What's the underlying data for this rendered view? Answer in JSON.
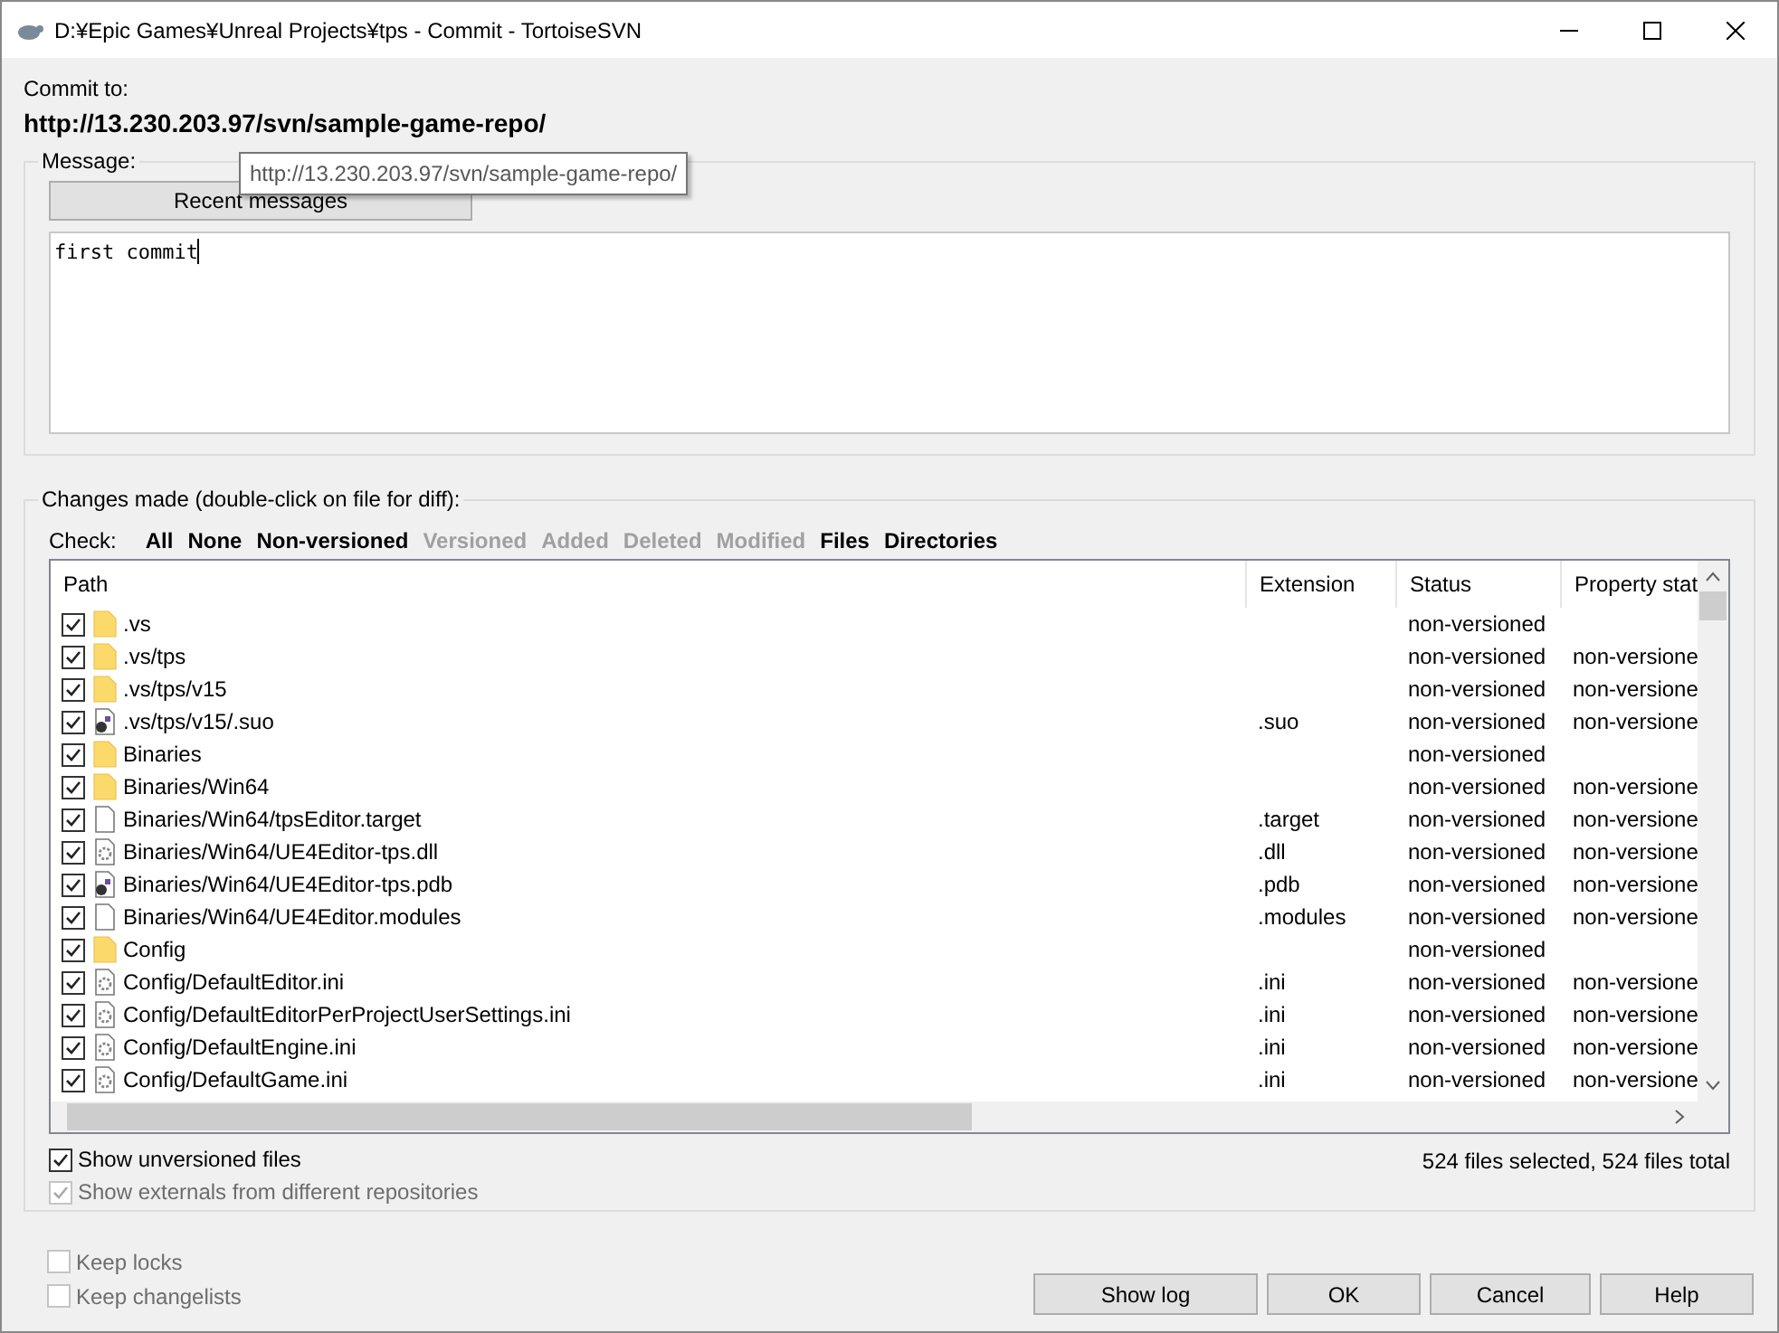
{
  "window": {
    "title": "D:¥Epic Games¥Unreal Projects¥tps - Commit - TortoiseSVN"
  },
  "commit_to": {
    "label": "Commit to:",
    "url": "http://13.230.203.97/svn/sample-game-repo/"
  },
  "tooltip": "http://13.230.203.97/svn/sample-game-repo/",
  "message": {
    "label": "Message:",
    "recent_button": "Recent messages",
    "value": "first commit "
  },
  "changes": {
    "label": "Changes made (double-click on file for diff):",
    "check_label": "Check:",
    "filters": [
      {
        "label": "All",
        "disabled": false
      },
      {
        "label": "None",
        "disabled": false
      },
      {
        "label": "Non-versioned",
        "disabled": false
      },
      {
        "label": "Versioned",
        "disabled": true
      },
      {
        "label": "Added",
        "disabled": true
      },
      {
        "label": "Deleted",
        "disabled": true
      },
      {
        "label": "Modified",
        "disabled": true
      },
      {
        "label": "Files",
        "disabled": false
      },
      {
        "label": "Directories",
        "disabled": false
      }
    ],
    "columns": [
      "Path",
      "Extension",
      "Status",
      "Property stat"
    ],
    "rows": [
      {
        "checked": true,
        "kind": "folder",
        "path": ".vs",
        "extension": "",
        "status": "non-versioned",
        "property_status": ""
      },
      {
        "checked": true,
        "kind": "folder",
        "path": ".vs/tps",
        "extension": "",
        "status": "non-versioned",
        "property_status": "non-versione"
      },
      {
        "checked": true,
        "kind": "folder",
        "path": ".vs/tps/v15",
        "extension": "",
        "status": "non-versioned",
        "property_status": "non-versione"
      },
      {
        "checked": true,
        "kind": "binary",
        "path": ".vs/tps/v15/.suo",
        "extension": ".suo",
        "status": "non-versioned",
        "property_status": "non-versione"
      },
      {
        "checked": true,
        "kind": "folder",
        "path": "Binaries",
        "extension": "",
        "status": "non-versioned",
        "property_status": ""
      },
      {
        "checked": true,
        "kind": "folder",
        "path": "Binaries/Win64",
        "extension": "",
        "status": "non-versioned",
        "property_status": "non-versione"
      },
      {
        "checked": true,
        "kind": "file",
        "path": "Binaries/Win64/tpsEditor.target",
        "extension": ".target",
        "status": "non-versioned",
        "property_status": "non-versione"
      },
      {
        "checked": true,
        "kind": "settings",
        "path": "Binaries/Win64/UE4Editor-tps.dll",
        "extension": ".dll",
        "status": "non-versioned",
        "property_status": "non-versione"
      },
      {
        "checked": true,
        "kind": "binary",
        "path": "Binaries/Win64/UE4Editor-tps.pdb",
        "extension": ".pdb",
        "status": "non-versioned",
        "property_status": "non-versione"
      },
      {
        "checked": true,
        "kind": "file",
        "path": "Binaries/Win64/UE4Editor.modules",
        "extension": ".modules",
        "status": "non-versioned",
        "property_status": "non-versione"
      },
      {
        "checked": true,
        "kind": "folder",
        "path": "Config",
        "extension": "",
        "status": "non-versioned",
        "property_status": ""
      },
      {
        "checked": true,
        "kind": "settings",
        "path": "Config/DefaultEditor.ini",
        "extension": ".ini",
        "status": "non-versioned",
        "property_status": "non-versione"
      },
      {
        "checked": true,
        "kind": "settings",
        "path": "Config/DefaultEditorPerProjectUserSettings.ini",
        "extension": ".ini",
        "status": "non-versioned",
        "property_status": "non-versione"
      },
      {
        "checked": true,
        "kind": "settings",
        "path": "Config/DefaultEngine.ini",
        "extension": ".ini",
        "status": "non-versioned",
        "property_status": "non-versione"
      },
      {
        "checked": true,
        "kind": "settings",
        "path": "Config/DefaultGame.ini",
        "extension": ".ini",
        "status": "non-versioned",
        "property_status": "non-versione"
      }
    ],
    "summary": "524 files selected, 524 files total",
    "options": [
      {
        "label": "Show unversioned files",
        "checked": true,
        "disabled": false
      },
      {
        "label": "Show externals from different repositories",
        "checked": true,
        "disabled": true
      }
    ]
  },
  "bottom_options": [
    {
      "label": "Keep locks",
      "checked": false,
      "disabled": true
    },
    {
      "label": "Keep changelists",
      "checked": false,
      "disabled": true
    }
  ],
  "buttons": [
    "Show log",
    "OK",
    "Cancel",
    "Help"
  ]
}
